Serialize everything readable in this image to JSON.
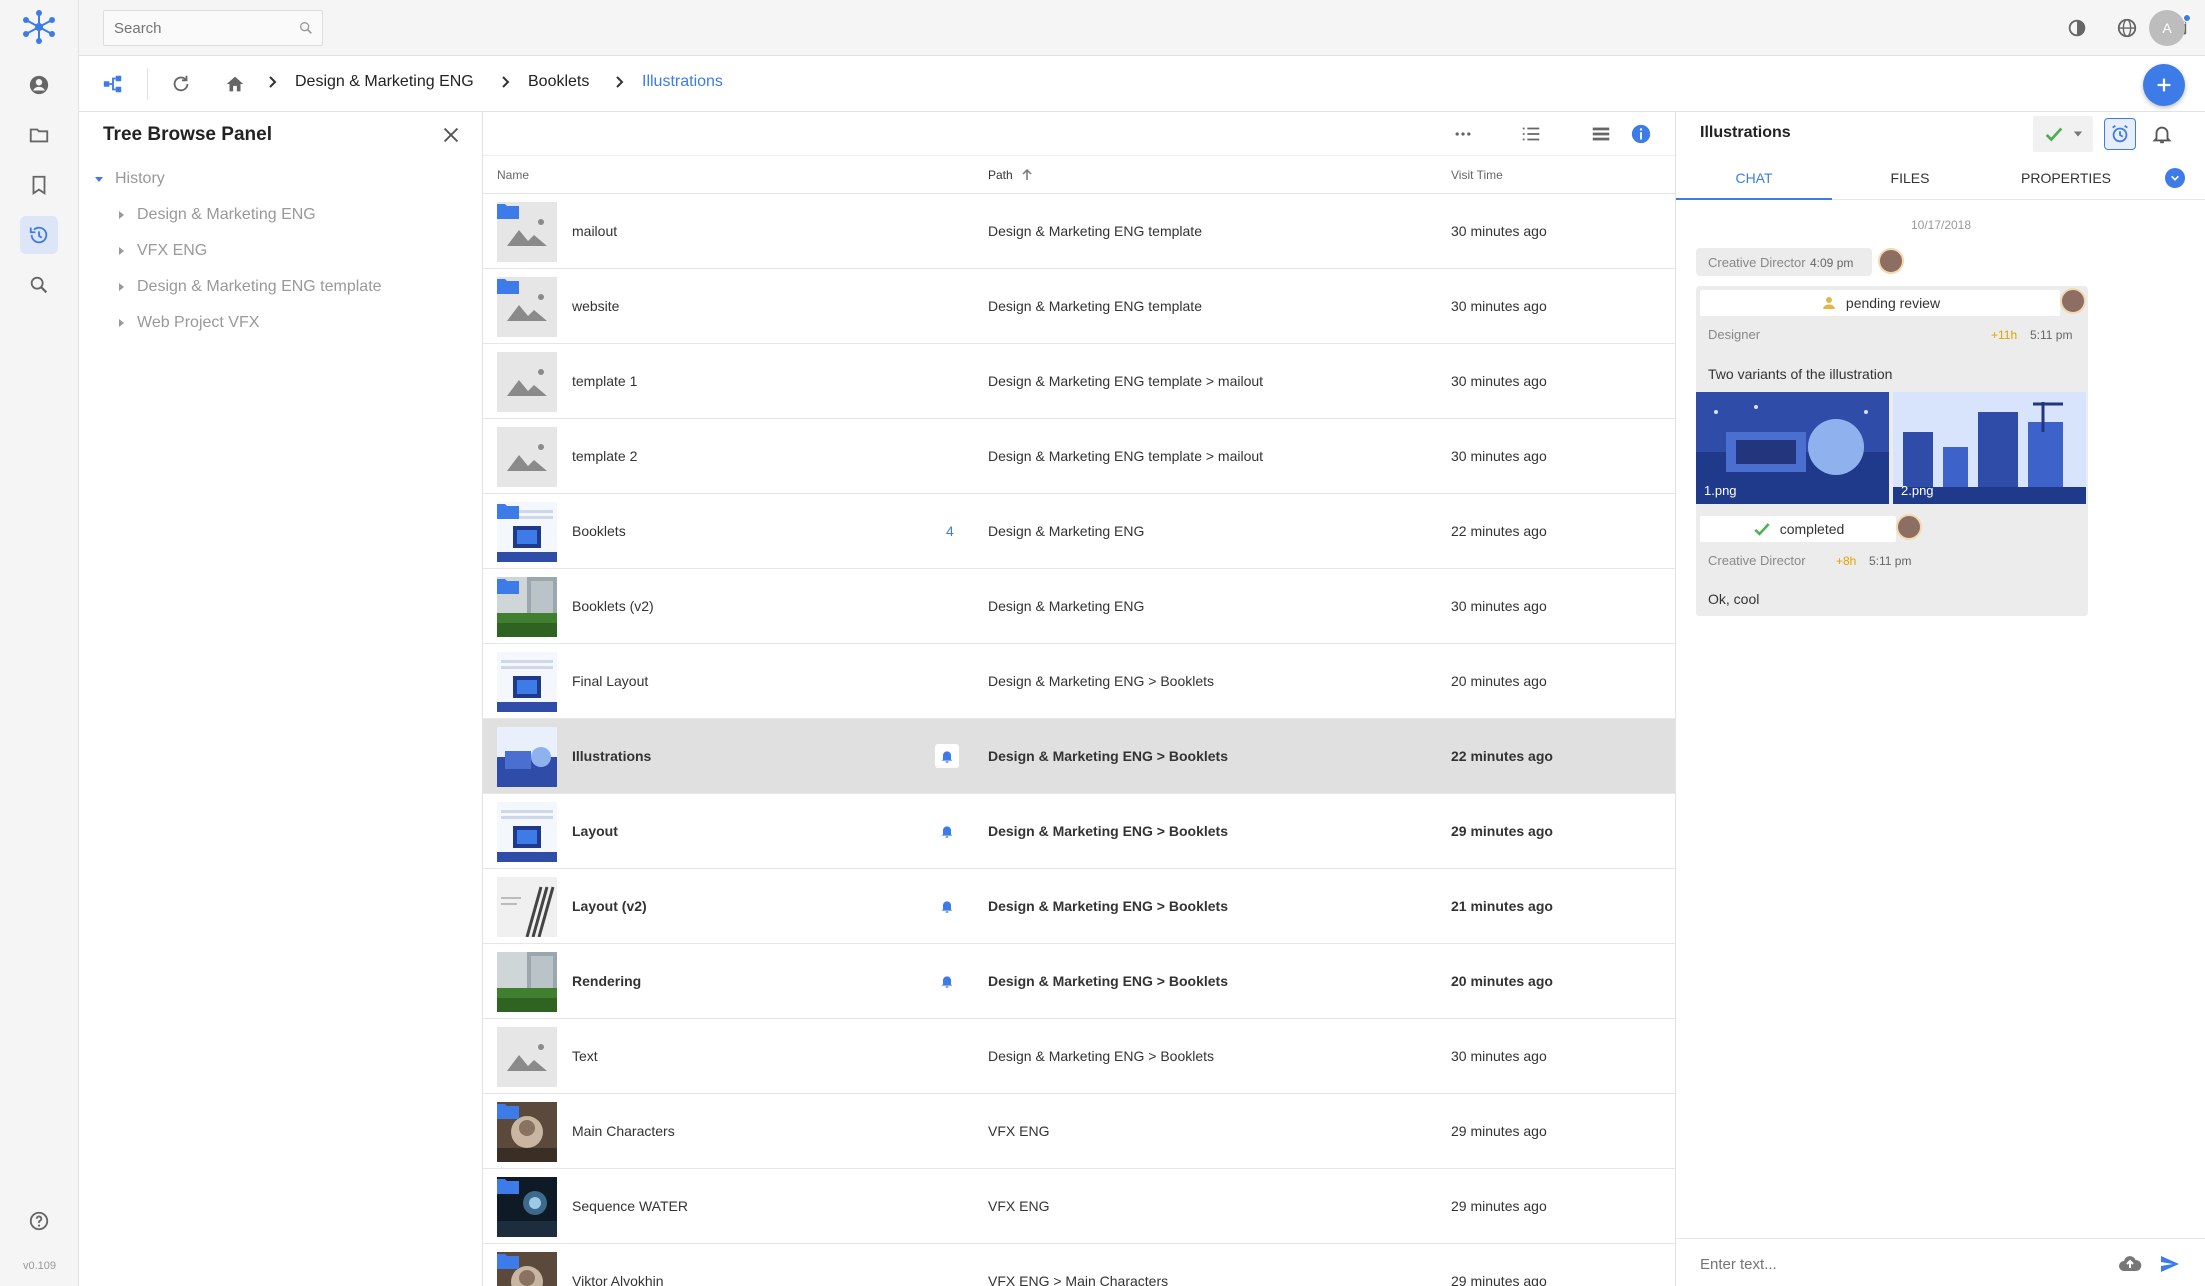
{
  "app": {
    "version": "v0.109",
    "accent": "#3d7be8"
  },
  "topbar": {
    "search_placeholder": "Search",
    "avatar_initial": "A"
  },
  "breadcrumb": {
    "items": [
      "Design & Marketing ENG",
      "Booklets",
      "Illustrations"
    ]
  },
  "tree": {
    "title": "Tree Browse Panel",
    "root": "History",
    "items": [
      "Design & Marketing ENG",
      "VFX ENG",
      "Design & Marketing ENG template",
      "Web Project VFX"
    ]
  },
  "list": {
    "columns": {
      "name": "Name",
      "path": "Path",
      "visit_time": "Visit Time"
    },
    "rows": [
      {
        "name": "mailout",
        "path": "Design & Marketing ENG template",
        "time": "30 minutes ago",
        "thumb": "placeholder",
        "folder": true
      },
      {
        "name": "website",
        "path": "Design & Marketing ENG template",
        "time": "30 minutes ago",
        "thumb": "placeholder",
        "folder": true
      },
      {
        "name": "template 1",
        "path": "Design & Marketing ENG template > mailout",
        "time": "30 minutes ago",
        "thumb": "placeholder",
        "folder": false
      },
      {
        "name": "template 2",
        "path": "Design & Marketing ENG template > mailout",
        "time": "30 minutes ago",
        "thumb": "placeholder",
        "folder": false
      },
      {
        "name": "Booklets",
        "count": "4",
        "path": "Design & Marketing ENG",
        "time": "22 minutes ago",
        "thumb": "booklet",
        "folder": true
      },
      {
        "name": "Booklets (v2)",
        "path": "Design & Marketing ENG",
        "time": "30 minutes ago",
        "thumb": "green",
        "folder": true
      },
      {
        "name": "Final Layout",
        "path": "Design & Marketing ENG > Booklets",
        "time": "20 minutes ago",
        "thumb": "booklet",
        "folder": false
      },
      {
        "name": "Illustrations",
        "path": "Design & Marketing ENG > Booklets",
        "time": "22 minutes ago",
        "thumb": "illustration",
        "folder": false,
        "bell": true,
        "selected": true,
        "bold": true
      },
      {
        "name": "Layout",
        "path": "Design & Marketing ENG > Booklets",
        "time": "29 minutes ago",
        "thumb": "booklet",
        "folder": false,
        "bell": true,
        "bold": true
      },
      {
        "name": "Layout (v2)",
        "path": "Design & Marketing ENG > Booklets",
        "time": "21 minutes ago",
        "thumb": "lines",
        "folder": false,
        "bell": true,
        "bold": true
      },
      {
        "name": "Rendering",
        "path": "Design & Marketing ENG > Booklets",
        "time": "20 minutes ago",
        "thumb": "green",
        "folder": false,
        "bell": true,
        "bold": true
      },
      {
        "name": "Text",
        "path": "Design & Marketing ENG > Booklets",
        "time": "30 minutes ago",
        "thumb": "placeholder",
        "folder": false
      },
      {
        "name": "Main Characters",
        "path": "VFX ENG",
        "time": "29 minutes ago",
        "thumb": "character",
        "folder": true
      },
      {
        "name": "Sequence WATER",
        "path": "VFX ENG",
        "time": "29 minutes ago",
        "thumb": "dark",
        "folder": true
      },
      {
        "name": "Viktor Alyokhin",
        "path": "VFX ENG > Main Characters",
        "time": "29 minutes ago",
        "thumb": "character",
        "folder": true
      }
    ]
  },
  "detail": {
    "title": "Illustrations",
    "tabs": [
      "CHAT",
      "FILES",
      "PROPERTIES"
    ],
    "date": "10/17/2018",
    "messages": {
      "m1": {
        "author": "Creative Director",
        "time": "4:09 pm"
      },
      "m2": {
        "status": "pending review",
        "author": "Designer",
        "delay": "+11h",
        "time": "5:11 pm",
        "text": "Two variants of the illustration",
        "attachments": [
          "1.png",
          "2.png"
        ]
      },
      "m3": {
        "status": "completed",
        "author": "Creative Director",
        "delay": "+8h",
        "time": "5:11 pm",
        "text": "Ok, cool"
      }
    },
    "composer_placeholder": "Enter text..."
  }
}
